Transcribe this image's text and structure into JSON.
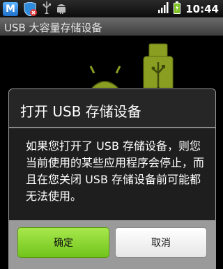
{
  "status_bar": {
    "notification_m": "M",
    "time": "10:44",
    "icons": [
      "m-app-icon",
      "shield-icon",
      "usb-icon",
      "android-debug-icon",
      "signal-icon",
      "battery-icon"
    ]
  },
  "app": {
    "title": "USB 大容量存储设备"
  },
  "dialog": {
    "title": "打开 USB 存储设备",
    "message": "如果您打开了 USB 存储设备，则您当前使用的某些应用程序会停止，而且在您关闭 USB 存储设备前可能都无法使用。",
    "ok_label": "确定",
    "cancel_label": "取消"
  },
  "colors": {
    "ok_button": "#8bd62e",
    "android_green": "#8a9e22",
    "title_bar": "#555555"
  }
}
